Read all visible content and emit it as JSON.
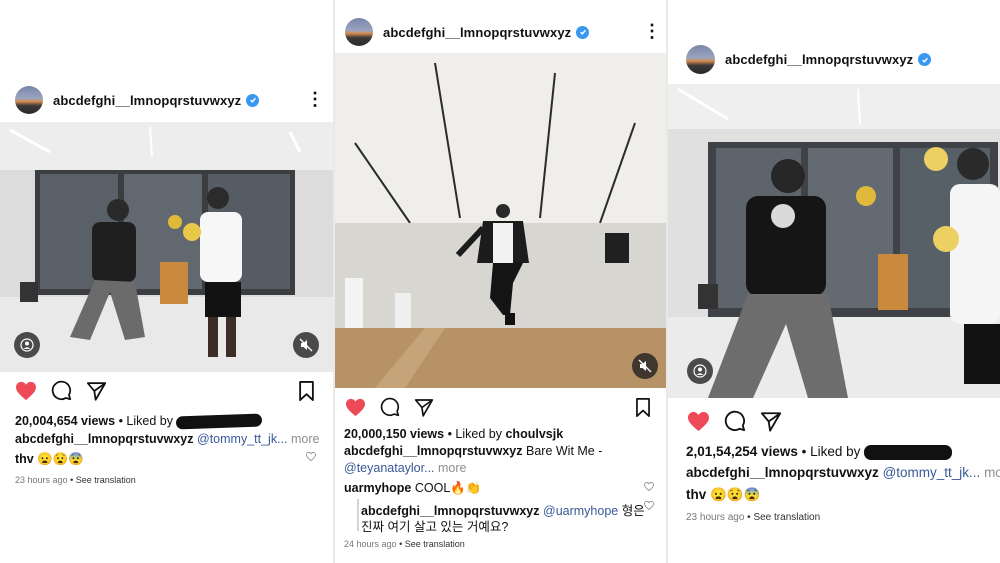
{
  "colors": {
    "like": "#ed4956",
    "verified": "#3897f0",
    "mention": "#385898",
    "muted": "#8e8e8e"
  },
  "posts": [
    {
      "username": "abcdefghi__lmnopqrstuvwxyz",
      "views": "20,004,654 views",
      "liked_by_prefix": "• Liked by",
      "caption_user": "abcdefghi__lmnopqrstuvwxyz",
      "caption_mention": "@tommy_tt_jk...",
      "more": "more",
      "comment_user": "thv",
      "comment_text": "😦😧😨",
      "timestamp": "23 hours ago",
      "translation": "• See translation",
      "icons": [
        "profile-icon",
        "mute-icon",
        "heart-icon",
        "comment-icon",
        "share-icon",
        "bookmark-icon"
      ]
    },
    {
      "username": "abcdefghi__lmnopqrstuvwxyz",
      "views": "20,000,150 views",
      "liked_by_prefix": "• Liked by",
      "liked_by_user": "choulvsjk",
      "caption_user": "abcdefghi__lmnopqrstuvwxyz",
      "caption_text": "Bare Wit Me -",
      "caption_mention": "@teyanataylor...",
      "more": "more",
      "comment_user": "uarmyhope",
      "comment_text": "COOL🔥👏",
      "reply_user": "abcdefghi__lmnopqrstuvwxyz",
      "reply_mention": "@uarmyhope",
      "reply_text_1": "형은",
      "reply_text_2": "진짜 여기 살고 있는 거예요?",
      "timestamp": "24 hours ago",
      "translation": "• See translation"
    },
    {
      "username": "abcdefghi__lmnopqrstuvwxyz",
      "views": "2,01,54,254 views",
      "liked_by_prefix": "• Liked by",
      "caption_user": "abcdefghi__lmnopqrstuvwxyz",
      "caption_mention": "@tommy_tt_jk...",
      "more": "more",
      "comment_user": "thv",
      "comment_text": "😦😧😨",
      "timestamp": "23 hours ago",
      "translation": "• See translation"
    }
  ]
}
